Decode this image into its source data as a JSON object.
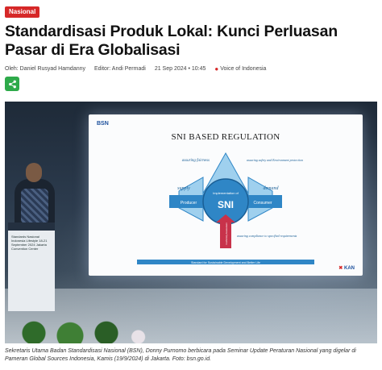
{
  "category_badge": "Nasional",
  "article": {
    "title": "Standardisasi Produk Lokal: Kunci Perluasan Pasar di Era Globalisasi",
    "author": "Oleh: Daniel Rusyad Hamdanny",
    "editor": "Editor: Andi Permadi",
    "datetime": "21 Sep 2024 • 10:45",
    "source": "Voice of Indonesia"
  },
  "share": {
    "icon": "share-icon",
    "color": "#2eaa4a"
  },
  "photo": {
    "screen_logo": "BSN",
    "slide_title": "SNI BASED REGULATION",
    "slide_center": "SNI",
    "slide_center_sub": "Implementation of",
    "slide_labels": {
      "top": "assuring fairness",
      "top_right": "assuring safety and Environment protection",
      "left": "supply",
      "left_box": "Producer",
      "right": "demand",
      "right_box": "Consumer",
      "bottom": "assuring compliance to specified requirements",
      "bottom_arrow": "Conformity Assessment",
      "footer": "Standard for Sustainable Development and Better Life"
    },
    "kan_logo": "KAN",
    "podium_text": "Standards Nasional Indonesia Lifestyle 18-21 September 2024 Jakarta Convention Center"
  },
  "caption": "Sekretaris Utama Badan Standardisasi Nasional (BSN), Donny Purnomo berbicara pada Seminar Update Peraturan Nasional yang digelar di Pameran Global Sources Indonesia, Kamis (19/9/2024) di Jakarta. Foto: bsn.go.id.",
  "colors": {
    "accent": "#d62828",
    "share": "#2eaa4a",
    "slide_blue": "#2f86c6",
    "slide_red": "#c8324a"
  }
}
